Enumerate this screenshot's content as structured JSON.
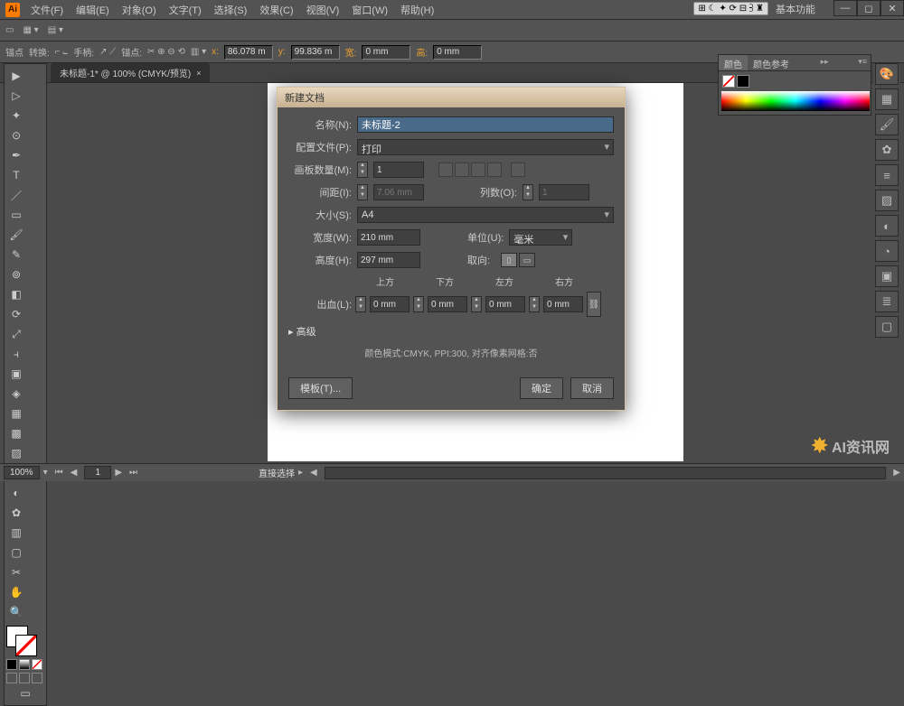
{
  "app": {
    "logo": "Ai"
  },
  "menus": [
    "文件(F)",
    "编辑(E)",
    "对象(O)",
    "文字(T)",
    "选择(S)",
    "效果(C)",
    "视图(V)",
    "窗口(W)",
    "帮助(H)"
  ],
  "essentials_icons": "⊞ ☾ ✦ ⟳ ⊟ ⫖ ♜",
  "essentials_label": "基本功能",
  "win_ctrl": {
    "min": "—",
    "max": "◻",
    "close": "✕"
  },
  "optbar": {
    "anchor": "锚点",
    "convert": "转换:",
    "handles": "手柄:",
    "anchors": "锚点:",
    "x_val": "86.078 m",
    "y_val": "99.836 m",
    "w_val": "0 mm",
    "h_val": "0 mm"
  },
  "doc": {
    "tab": "未标题-1* @ 100% (CMYK/预览)",
    "close": "×"
  },
  "status": {
    "zoom": "100%",
    "artboard": "1",
    "tool": "直接选择"
  },
  "color_panel": {
    "tab1": "颜色",
    "tab2": "颜色参考",
    "rr": "▸▸"
  },
  "dialog": {
    "title": "新建文档",
    "name_label": "名称(N):",
    "name_value": "未标题-2",
    "profile_label": "配置文件(P):",
    "profile_value": "打印",
    "artboards_label": "画板数量(M):",
    "artboards_value": "1",
    "spacing_label": "间距(I):",
    "spacing_value": "7.06 mm",
    "cols_label": "列数(O):",
    "cols_value": "1",
    "size_label": "大小(S):",
    "size_value": "A4",
    "width_label": "宽度(W):",
    "width_value": "210 mm",
    "units_label": "单位(U):",
    "units_value": "毫米",
    "height_label": "高度(H):",
    "height_value": "297 mm",
    "orient_label": "取向:",
    "bleed_label": "出血(L):",
    "bleed_top": "上方",
    "bleed_bottom": "下方",
    "bleed_left": "左方",
    "bleed_right": "右方",
    "bleed_val": "0 mm",
    "advanced": "高级",
    "summary": "颜色模式:CMYK, PPI:300, 对齐像素网格:否",
    "template_btn": "模板(T)...",
    "ok_btn": "确定",
    "cancel_btn": "取消",
    "link": "⛓"
  },
  "watermark": "AI资讯网"
}
